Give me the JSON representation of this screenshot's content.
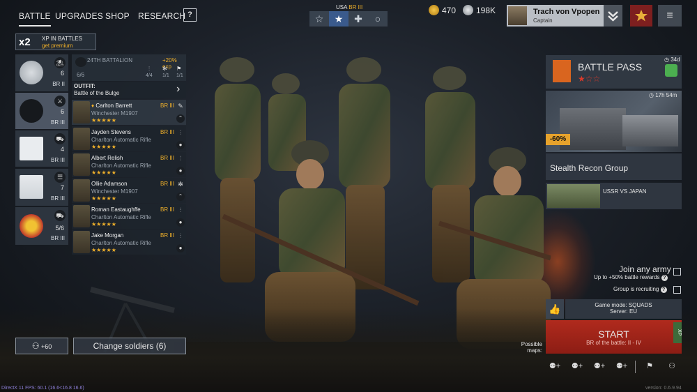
{
  "nav": {
    "tabs": [
      {
        "label": "BATTLE",
        "active": true
      },
      {
        "label": "UPGRADES"
      },
      {
        "label": "SHOP"
      },
      {
        "label": "RESEARCH"
      }
    ],
    "help_label": "?"
  },
  "army_selector": {
    "nation": "USA",
    "br": "BR III",
    "buttons": [
      "star-outline-icon",
      "star-badge-icon",
      "cross-icon",
      "circle-icon"
    ]
  },
  "currency": {
    "gold": "470",
    "silver": "198K"
  },
  "profile": {
    "name": "Trach von Vpopen",
    "rank": "Captain"
  },
  "xp_badge": {
    "multiplier": "x2",
    "text": "XP IN BATTLES",
    "cta": "get premium"
  },
  "squads": [
    {
      "count": "6",
      "br": "BR II"
    },
    {
      "count": "6",
      "br": "BR III",
      "selected": true
    },
    {
      "count": "4",
      "br": "BR III"
    },
    {
      "count": "7",
      "br": "BR III"
    },
    {
      "count": "5/6",
      "br": "BR III"
    }
  ],
  "battalion": {
    "name": "24TH BATTALION",
    "exp_bonus": "+20% exp",
    "slots": "6/6",
    "stat1": "4/4",
    "stat2": "1/1",
    "stat3": "1/1",
    "outfit_label": "OUTFIT:",
    "outfit_name": "Battle of the Bulge"
  },
  "soldiers": [
    {
      "name": "Carlton Barrett",
      "weapon": "Winchester M1907",
      "br": "BR III",
      "stars": "★★★★★"
    },
    {
      "name": "Jayden Stevens",
      "weapon": "Charlton Automatic Rifle",
      "br": "BR III",
      "stars": "★★★★★"
    },
    {
      "name": "Albert Relish",
      "weapon": "Charlton Automatic Rifle",
      "br": "BR III",
      "stars": "★★★★★"
    },
    {
      "name": "Ollie Adamson",
      "weapon": "Winchester M1907",
      "br": "BR III",
      "stars": "★★★★★"
    },
    {
      "name": "Roman Eastaughffe",
      "weapon": "Charlton Automatic Rifle",
      "br": "BR III",
      "stars": "★★★★★"
    },
    {
      "name": "Jake Morgan",
      "weapon": "Charlton Automatic Rifle",
      "br": "BR III",
      "stars": "★★★★★"
    }
  ],
  "bottom_left": {
    "add_count": "+60",
    "change_soldiers": "Change soldiers (6)"
  },
  "battle_pass": {
    "title": "BATTLE PASS",
    "stars": "★☆☆",
    "timer": "34d"
  },
  "promo": {
    "timer": "17h 54m",
    "discount": "-60%",
    "title": "Stealth Recon Group"
  },
  "event": {
    "label": "USSR VS JAPAN"
  },
  "options": {
    "join_any_army": "Join any army",
    "join_bonus": "Up to +50% battle rewards",
    "group_recruiting": "Group is recruiting"
  },
  "game_info": {
    "mode": "Game mode: SQUADS",
    "server": "Server: EU"
  },
  "start": {
    "label": "START",
    "sub": "BR of the battle: II - IV",
    "xp_tag": "XP"
  },
  "possible_maps": "Possible maps:",
  "debug": "DirectX 11 FPS: 60.1 (16.6<16.8 16.6)",
  "version": "version: 0.6.9.94"
}
